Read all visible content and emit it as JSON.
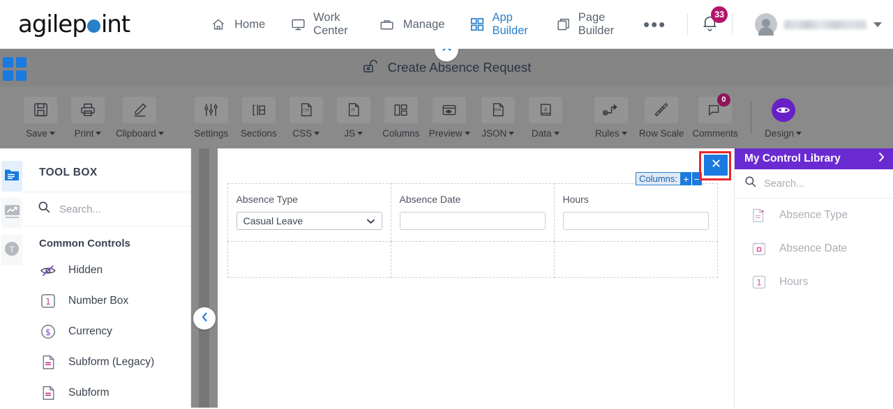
{
  "brand": {
    "name_part1": "agilep",
    "name_part2": "int",
    "accent": "#2a7fc9"
  },
  "topnav": {
    "items": [
      {
        "label": "Home",
        "icon": "home-icon",
        "active": false
      },
      {
        "label": "Work Center",
        "icon": "monitor-icon",
        "active": false
      },
      {
        "label": "Manage",
        "icon": "briefcase-icon",
        "active": false
      },
      {
        "label": "App Builder",
        "icon": "grid-icon",
        "active": true
      },
      {
        "label": "Page Builder",
        "icon": "copy-icon",
        "active": false
      }
    ],
    "more_label": "•••",
    "notifications": {
      "count": "33",
      "icon": "bell-icon",
      "badge_color": "#b5146b"
    },
    "user": {
      "name": "",
      "icon": "avatar-icon"
    }
  },
  "titlebar": {
    "title": "Create Absence Request",
    "lock_icon": "unlock-icon",
    "grid_icon": "grid-apps-icon",
    "collapse_icon": "chevron-up-icon"
  },
  "toolbar": {
    "items": [
      {
        "label": "Save",
        "icon": "floppy-disk-icon",
        "dropdown": true
      },
      {
        "label": "Print",
        "icon": "printer-icon",
        "dropdown": true
      },
      {
        "label": "Clipboard",
        "icon": "pencil-icon",
        "dropdown": true
      },
      {
        "label": "Settings",
        "icon": "sliders-icon",
        "dropdown": false
      },
      {
        "label": "Sections",
        "icon": "sections-icon",
        "dropdown": false
      },
      {
        "label": "CSS",
        "icon": "css-file-icon",
        "dropdown": true
      },
      {
        "label": "JS",
        "icon": "js-file-icon",
        "dropdown": true
      },
      {
        "label": "Columns",
        "icon": "columns-layout-icon",
        "dropdown": false
      },
      {
        "label": "Preview",
        "icon": "eye-window-icon",
        "dropdown": true
      },
      {
        "label": "JSON",
        "icon": "json-file-icon",
        "dropdown": true
      },
      {
        "label": "Data",
        "icon": "book-a-icon",
        "dropdown": true
      },
      {
        "label": "Rules",
        "icon": "rules-flow-icon",
        "dropdown": true
      },
      {
        "label": "Row Scale",
        "icon": "ruler-icon",
        "dropdown": false
      },
      {
        "label": "Comments",
        "icon": "comment-bubble-icon",
        "dropdown": false,
        "badge": "0"
      }
    ],
    "design": {
      "label": "Design",
      "icon": "eye-icon",
      "dropdown": true,
      "color": "#6720c7"
    }
  },
  "rail": {
    "buttons": [
      {
        "name": "toolbox-tab",
        "icon": "folder-list-icon",
        "active": true
      },
      {
        "name": "analytics-tab",
        "icon": "chart-icon",
        "active": false
      },
      {
        "name": "text-tab",
        "icon": "t-circle-icon",
        "active": false
      }
    ]
  },
  "toolbox": {
    "title": "TOOL BOX",
    "search": {
      "placeholder": "Search...",
      "value": "",
      "icon": "search-icon"
    },
    "group_label": "Common Controls",
    "items": [
      {
        "label": "Hidden",
        "icon": "eye-off-icon"
      },
      {
        "label": "Number Box",
        "icon": "number-one-icon"
      },
      {
        "label": "Currency",
        "icon": "currency-dollar-icon"
      },
      {
        "label": "Subform (Legacy)",
        "icon": "subform-legacy-icon"
      },
      {
        "label": "Subform",
        "icon": "subform-icon"
      }
    ],
    "collapse_icon": "chevron-left-icon"
  },
  "canvas": {
    "columns_control": {
      "label": "Columns:",
      "add": "+",
      "remove": "−"
    },
    "close_button": {
      "icon": "close-icon",
      "color": "#1a7ae0",
      "highlight_color": "#e8262a"
    },
    "fields": [
      {
        "label": "Absence Type",
        "type": "select",
        "value": "Casual Leave"
      },
      {
        "label": "Absence Date",
        "type": "text",
        "value": ""
      },
      {
        "label": "Hours",
        "type": "text",
        "value": ""
      }
    ],
    "empty_cells": 3
  },
  "control_library": {
    "title": "My Control Library",
    "expand_icon": "chevron-right-icon",
    "search": {
      "placeholder": "Search...",
      "value": "",
      "icon": "search-icon"
    },
    "sort_icon": "sort-icon",
    "items": [
      {
        "label": "Absence Type",
        "icon": "dropdown-control-icon"
      },
      {
        "label": "Absence Date",
        "icon": "calendar-control-icon"
      },
      {
        "label": "Hours",
        "icon": "number-control-icon"
      }
    ]
  }
}
